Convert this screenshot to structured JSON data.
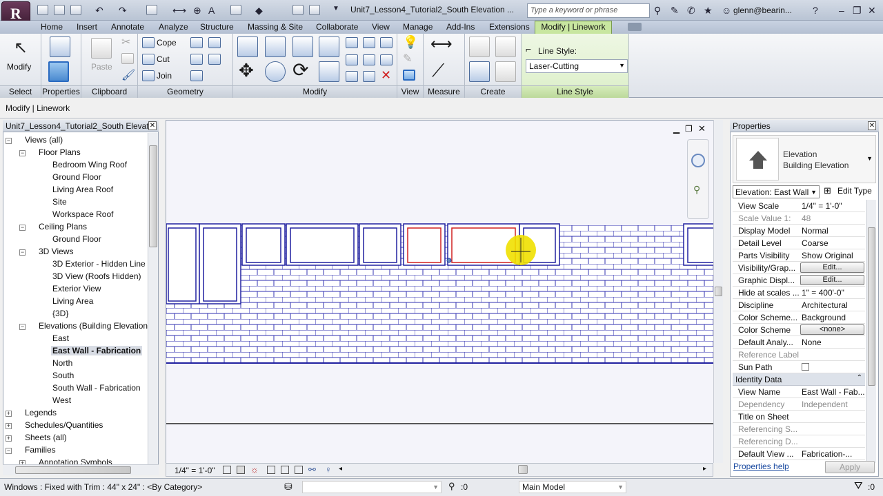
{
  "app": {
    "logo_letter": "R",
    "document_title": "Unit7_Lesson4_Tutorial2_South Elevation ...",
    "search_placeholder": "Type a keyword or phrase",
    "user": "glenn@bearin..."
  },
  "tabs": [
    "Home",
    "Insert",
    "Annotate",
    "Analyze",
    "Structure",
    "Massing & Site",
    "Collaborate",
    "View",
    "Manage",
    "Add-Ins",
    "Extensions"
  ],
  "active_tab": "Modify | Linework",
  "ribbon": {
    "modify_label": "Modify",
    "properties_label": "Properties",
    "paste_label": "Paste",
    "cope_label": "Cope",
    "cut_label": "Cut",
    "join_label": "Join",
    "line_style_label": "Line Style:",
    "line_style_value": "Laser-Cutting",
    "panels": {
      "select": "Select",
      "properties": "Properties",
      "clipboard": "Clipboard",
      "geometry": "Geometry",
      "modify": "Modify",
      "view": "View",
      "measure": "Measure",
      "create": "Create",
      "line_style": "Line Style"
    }
  },
  "context_bar": "Modify | Linework",
  "project_browser": {
    "title": "Unit7_Lesson4_Tutorial2_South Elevat...",
    "items": [
      {
        "label": "Views (all)",
        "level": 0,
        "toggle": "−"
      },
      {
        "label": "Floor Plans",
        "level": 1,
        "toggle": "−"
      },
      {
        "label": "Bedroom Wing Roof",
        "level": 2
      },
      {
        "label": "Ground Floor",
        "level": 2
      },
      {
        "label": "Living Area Roof",
        "level": 2
      },
      {
        "label": "Site",
        "level": 2
      },
      {
        "label": "Workspace Roof",
        "level": 2
      },
      {
        "label": "Ceiling Plans",
        "level": 1,
        "toggle": "−"
      },
      {
        "label": "Ground Floor",
        "level": 2
      },
      {
        "label": "3D Views",
        "level": 1,
        "toggle": "−"
      },
      {
        "label": "3D Exterior - Hidden Line",
        "level": 2
      },
      {
        "label": "3D View (Roofs Hidden)",
        "level": 2
      },
      {
        "label": "Exterior View",
        "level": 2
      },
      {
        "label": "Living Area",
        "level": 2
      },
      {
        "label": "{3D}",
        "level": 2
      },
      {
        "label": "Elevations (Building Elevation",
        "level": 1,
        "toggle": "−"
      },
      {
        "label": "East",
        "level": 2
      },
      {
        "label": "East Wall - Fabrication",
        "level": 2,
        "selected": true
      },
      {
        "label": "North",
        "level": 2
      },
      {
        "label": "South",
        "level": 2
      },
      {
        "label": "South Wall - Fabrication",
        "level": 2
      },
      {
        "label": "West",
        "level": 2
      },
      {
        "label": "Legends",
        "level": 0,
        "toggle": "+"
      },
      {
        "label": "Schedules/Quantities",
        "level": 0,
        "toggle": "+"
      },
      {
        "label": "Sheets (all)",
        "level": 0,
        "toggle": "+"
      },
      {
        "label": "Families",
        "level": 0,
        "toggle": "−"
      },
      {
        "label": "Annotation Symbols",
        "level": 1,
        "toggle": "+"
      }
    ]
  },
  "view_bar": {
    "scale": "1/4\" = 1'-0\""
  },
  "properties": {
    "title": "Properties",
    "type_name": "Elevation",
    "type_sub": "Building Elevation",
    "selector": "Elevation: East Wall",
    "edit_type": "Edit Type",
    "rows": [
      {
        "k": "View Scale",
        "v": "1/4\" = 1'-0\""
      },
      {
        "k": "Scale Value    1:",
        "v": "48",
        "disabled": true
      },
      {
        "k": "Display Model",
        "v": "Normal"
      },
      {
        "k": "Detail Level",
        "v": "Coarse"
      },
      {
        "k": "Parts Visibility",
        "v": "Show Original"
      },
      {
        "k": "Visibility/Grap...",
        "v": "Edit...",
        "button": true
      },
      {
        "k": "Graphic Displ...",
        "v": "Edit...",
        "button": true
      },
      {
        "k": "Hide at scales ...",
        "v": "1\" = 400'-0\""
      },
      {
        "k": "Discipline",
        "v": "Architectural"
      },
      {
        "k": "Color Scheme...",
        "v": "Background"
      },
      {
        "k": "Color Scheme",
        "v": "<none>",
        "button": true
      },
      {
        "k": "Default Analy...",
        "v": "None"
      },
      {
        "k": "Reference Label",
        "v": "",
        "disabled": true
      },
      {
        "k": "Sun Path",
        "v": "",
        "checkbox": true
      }
    ],
    "section": "Identity Data",
    "rows2": [
      {
        "k": "View Name",
        "v": "East Wall - Fab..."
      },
      {
        "k": "Dependency",
        "v": "Independent",
        "disabled": true
      },
      {
        "k": "Title on Sheet",
        "v": ""
      },
      {
        "k": "Referencing S...",
        "v": "",
        "disabled": true
      },
      {
        "k": "Referencing D...",
        "v": "",
        "disabled": true
      },
      {
        "k": "Default View ...",
        "v": "Fabrication-..."
      }
    ],
    "help_link": "Properties help",
    "apply": "Apply"
  },
  "status": {
    "message": "Windows : Fixed with Trim : 44\" x 24\" : <By Category>",
    "count": ":0",
    "model": "Main Model"
  },
  "colors": {
    "accent_green": "#c8e6a0",
    "linework_blue": "#2020a0",
    "selected_red": "#d02020",
    "highlight_yellow": "#f0e000"
  }
}
